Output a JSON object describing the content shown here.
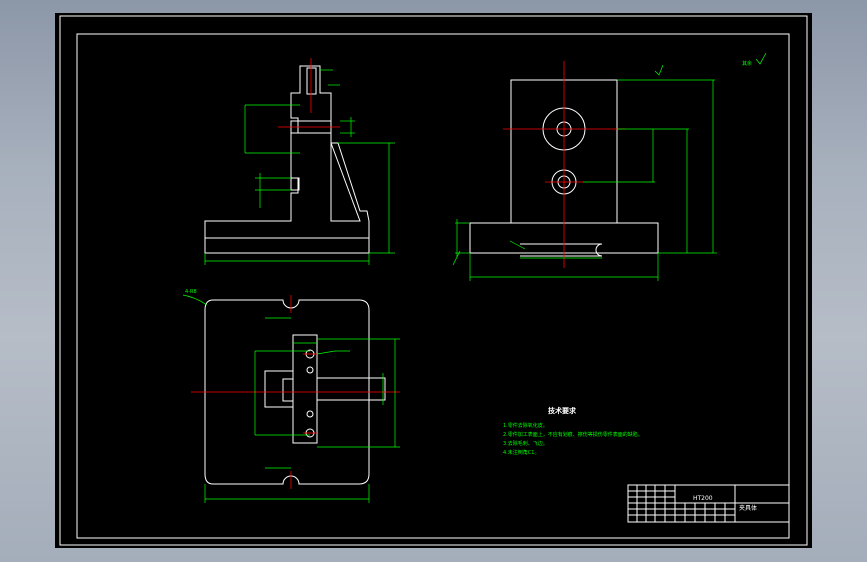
{
  "notes": {
    "title": "技术要求",
    "items": [
      "1.零件去除氧化皮。",
      "2.零件加工表面上，不应有划痕、擦伤等损伤零件表面的缺陷。",
      "3.去除毛刺、飞边。",
      "4.未注倒角C1。"
    ]
  },
  "title_block": {
    "material": "HT200",
    "part_name": "夹具体"
  },
  "roughness_note": "其余",
  "leaders": {
    "top_view_slot": "4-R8"
  },
  "colors": {
    "background": "#000000",
    "outline": "#ffffff",
    "dimension": "#00ff00",
    "centerline": "#ff0000"
  }
}
